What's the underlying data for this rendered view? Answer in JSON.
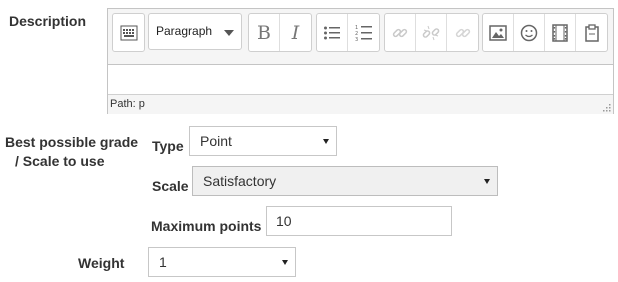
{
  "description": {
    "label": "Description",
    "editor": {
      "paragraph_select": "Paragraph",
      "path_label": "Path: p",
      "toolbar_icons": [
        "toolbar-toggle-icon",
        "bold-icon",
        "italic-icon",
        "bullet-list-icon",
        "numbered-list-icon",
        "link-icon",
        "unlink-icon",
        "anchor-icon",
        "image-icon",
        "emoticon-icon",
        "media-icon",
        "paste-icon"
      ],
      "bold_glyph": "B",
      "italic_glyph": "I"
    }
  },
  "grade": {
    "label_line1": "Best possible grade",
    "label_line2": "/ Scale to use",
    "type_label": "Type",
    "type_value": "Point",
    "scale_label": "Scale",
    "scale_value": "Satisfactory",
    "max_points_label": "Maximum points",
    "max_points_value": "10"
  },
  "weight": {
    "label": "Weight",
    "value": "1"
  }
}
